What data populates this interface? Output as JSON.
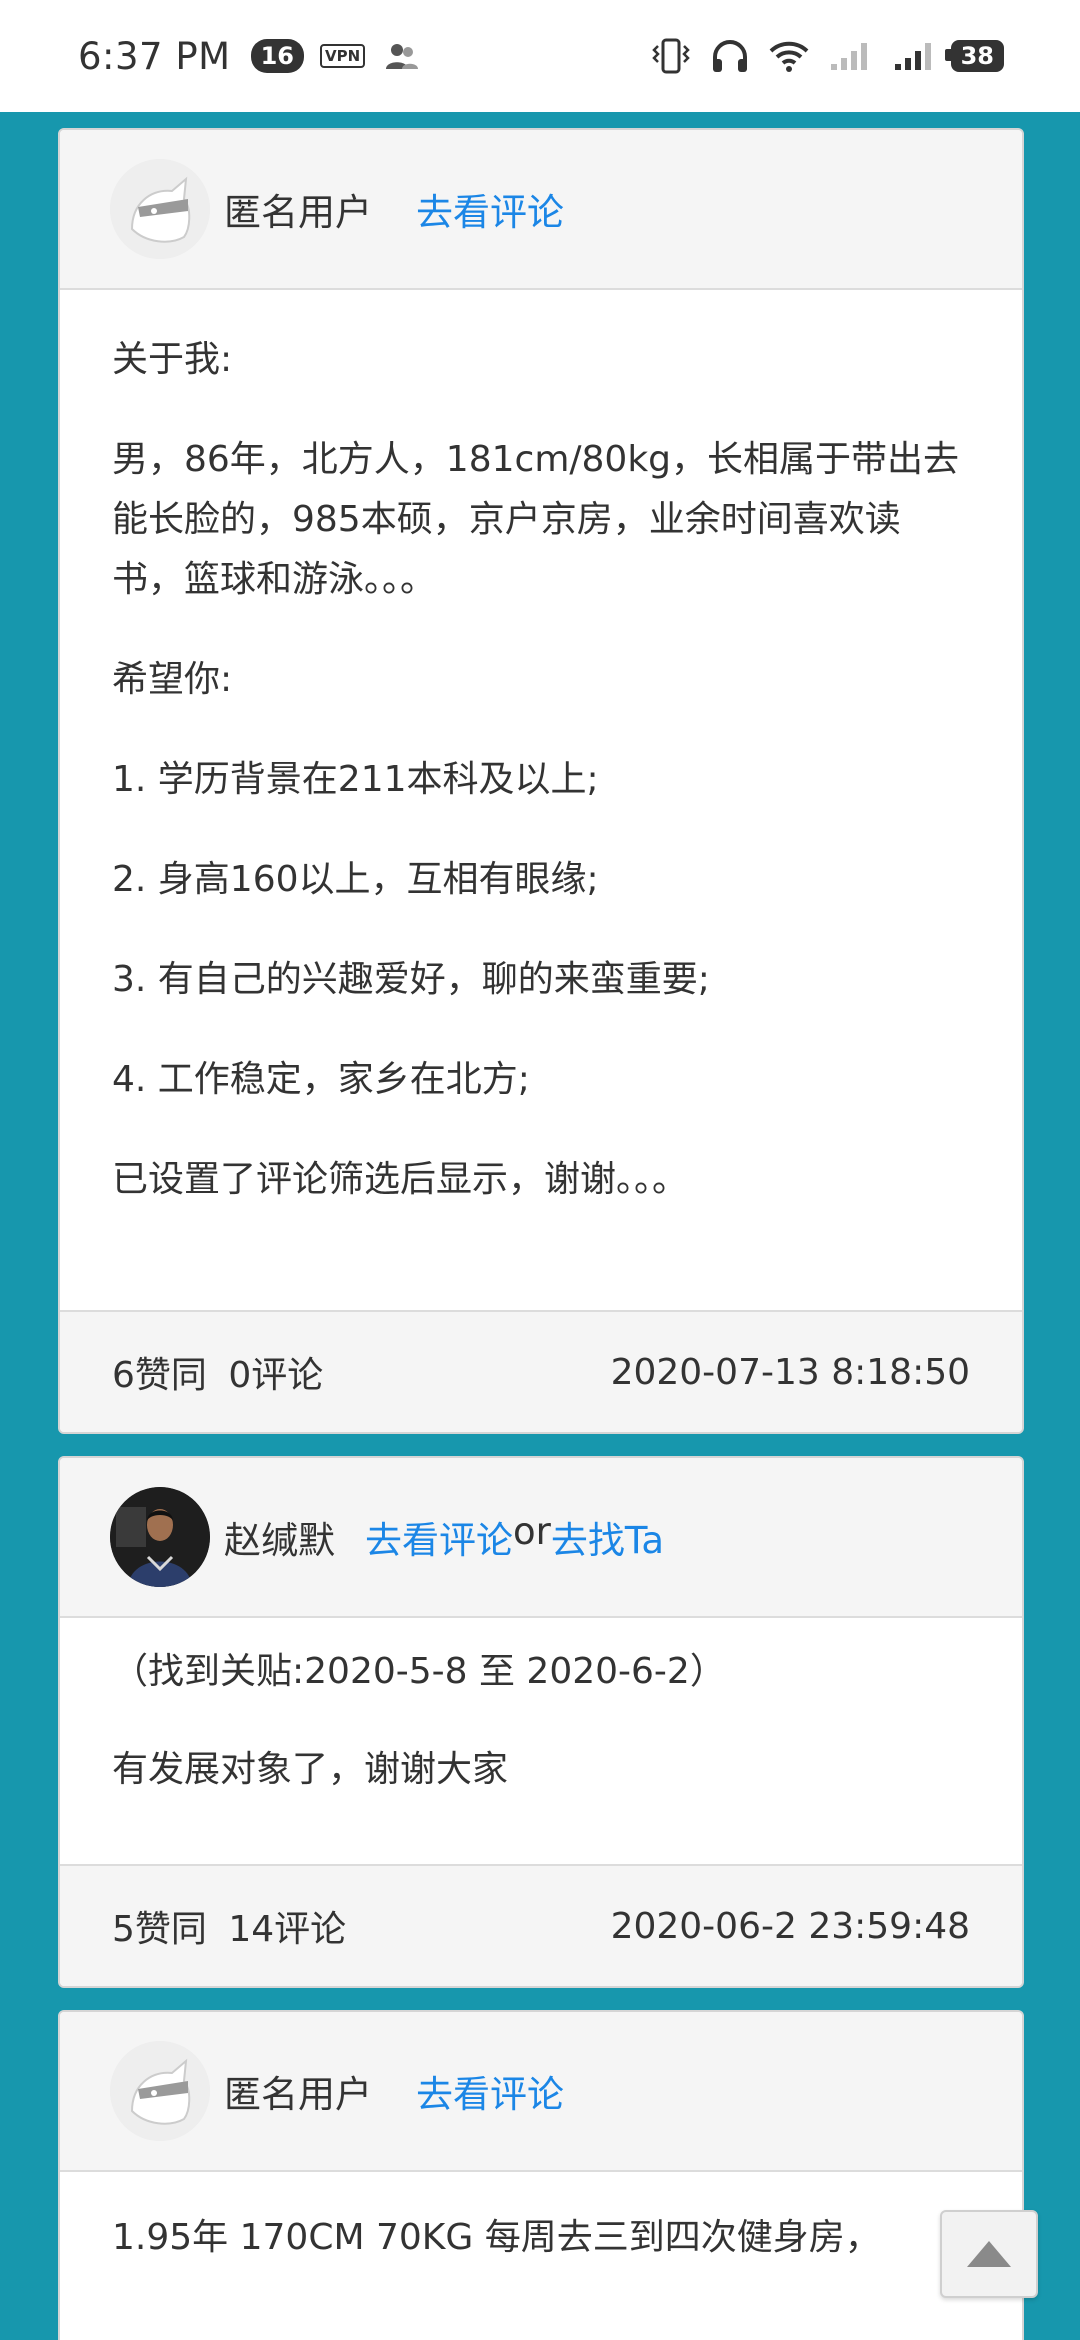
{
  "status_bar": {
    "time": "6:37 PM",
    "notification_count": "16",
    "vpn_label": "VPN",
    "battery": "38",
    "icons": [
      "vpn-icon",
      "user-icon",
      "vibrate-icon",
      "headphones-icon",
      "wifi-icon",
      "signal-icon",
      "signal-icon-2"
    ]
  },
  "posts": [
    {
      "author": "匿名用户",
      "link_comments": "去看评论",
      "paragraphs": [
        "关于我:",
        "男，86年，北方人，181cm/80kg，长相属于带出去能长脸的，985本硕，京户京房，业余时间喜欢读书，篮球和游泳。。。",
        "希望你:",
        "1. 学历背景在211本科及以上;",
        "2. 身高160以上，互相有眼缘;",
        "3. 有自己的兴趣爱好，聊的来蛮重要;",
        "4. 工作稳定，家乡在北方;",
        "已设置了评论筛选后显示，谢谢。。。"
      ],
      "likes": "6赞同",
      "comments": "0评论",
      "timestamp": "2020-07-13 8:18:50"
    },
    {
      "author": "赵缄默",
      "link_comments": "去看评论",
      "link_or": "or",
      "link_find": "去找Ta",
      "paragraphs": [
        "（找到关贴:2020-5-8 至 2020-6-2）",
        "有发展对象了，谢谢大家"
      ],
      "likes": "5赞同",
      "comments": "14评论",
      "timestamp": "2020-06-2 23:59:48"
    },
    {
      "author": "匿名用户",
      "link_comments": "去看评论",
      "paragraphs": [
        "1.95年 170CM 70KG 每周去三到四次健身房，"
      ]
    }
  ],
  "colors": {
    "background": "#1797ad",
    "link": "#1b86e6",
    "text": "#333333"
  },
  "scroll_top_icon": "arrow-up-icon"
}
